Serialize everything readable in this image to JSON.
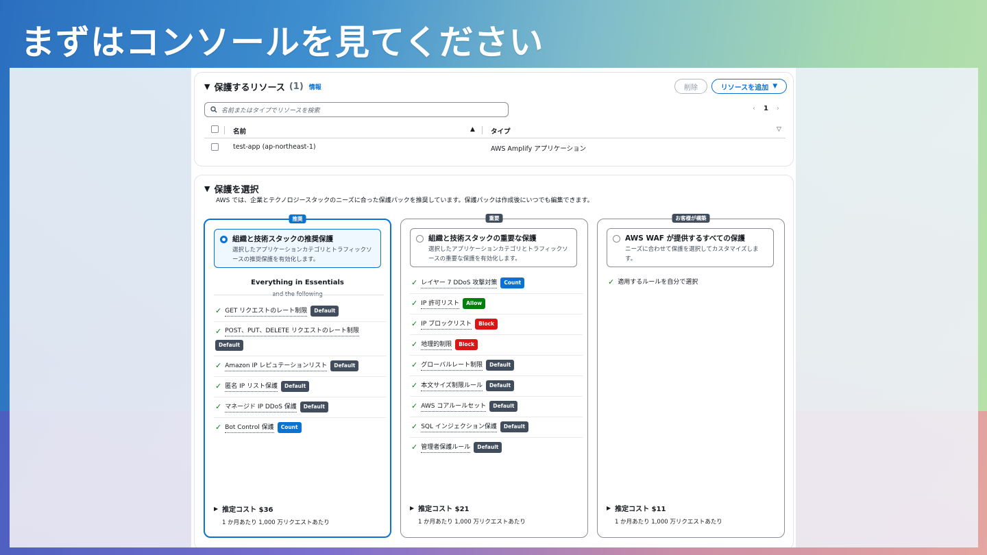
{
  "slide_title": "まずはコンソールを見てください",
  "resources": {
    "title": "保護するリソース",
    "count": "(1)",
    "info": "情報",
    "delete_label": "削除",
    "add_label": "リソースを追加",
    "search_placeholder": "名前またはタイプでリソースを検索",
    "page": "1",
    "columns": [
      "名前",
      "タイプ"
    ],
    "rows": [
      {
        "name": "test-app (ap-northeast-1)",
        "type": "AWS Amplify アプリケーション"
      }
    ]
  },
  "protection": {
    "title": "保護を選択",
    "description": "AWS では、企業とテクノロジースタックのニーズに合った保護パックを推奨しています。保護パックは作成後にいつでも編集できます。",
    "cards": [
      {
        "tag": "推奨",
        "title": "組織と技術スタックの推奨保護",
        "desc": "選択したアプリケーションカテゴリとトラフィックソースの推奨保護を有効化します。",
        "essentials_title": "Everything in Essentials",
        "essentials_sub": "and the following",
        "rules": [
          {
            "label": "GET リクエストのレート制限",
            "badge": "Default"
          },
          {
            "label": "POST、PUT、DELETE リクエストのレート制限",
            "badge": "Default"
          },
          {
            "label": "Amazon IP レピュテーションリスト",
            "badge": "Default"
          },
          {
            "label": "匿名 IP リスト保護",
            "badge": "Default"
          },
          {
            "label": "マネージド IP DDoS 保護",
            "badge": "Default"
          },
          {
            "label": "Bot Control 保護",
            "badge": "Count"
          }
        ],
        "cost_title": "推定コスト $36",
        "cost_sub": "1 か月あたり 1,000 万リクエストあたり"
      },
      {
        "tag": "重要",
        "title": "組織と技術スタックの重要な保護",
        "desc": "選択したアプリケーションカテゴリとトラフィックソースの重要な保護を有効化します。",
        "rules": [
          {
            "label": "レイヤー 7 DDoS 攻撃対策",
            "badge": "Count"
          },
          {
            "label": "IP 許可リスト",
            "badge": "Allow"
          },
          {
            "label": "IP ブロックリスト",
            "badge": "Block"
          },
          {
            "label": "地理的制限",
            "badge": "Block"
          },
          {
            "label": "グローバルレート制限",
            "badge": "Default"
          },
          {
            "label": "本文サイズ制限ルール",
            "badge": "Default"
          },
          {
            "label": "AWS コアルールセット",
            "badge": "Default"
          },
          {
            "label": "SQL インジェクション保護",
            "badge": "Default"
          },
          {
            "label": "管理者保護ルール",
            "badge": "Default"
          }
        ],
        "cost_title": "推定コスト $21",
        "cost_sub": "1 か月あたり 1,000 万リクエストあたり"
      },
      {
        "tag": "お客様が構築",
        "title": "AWS WAF が提供するすべての保護",
        "desc": "ニーズに合わせて保護を選択してカスタマイズします。",
        "rules": [
          {
            "label": "適用するルールを自分で選択",
            "badge": ""
          }
        ],
        "cost_title": "推定コスト $11",
        "cost_sub": "1 か月あたり 1,000 万リクエストあたり"
      }
    ]
  },
  "colors": {
    "accent": "#0972d3",
    "success": "#037f0c",
    "danger": "#d91515",
    "badge_default": "#414d5c"
  }
}
